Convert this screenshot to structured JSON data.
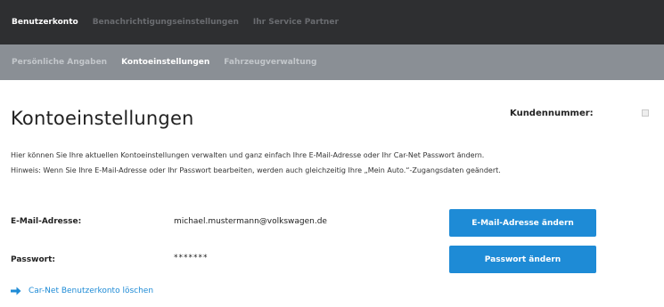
{
  "top_tabs": [
    {
      "label": "Benutzerkonto",
      "active": true
    },
    {
      "label": "Benachrichtigungseinstellungen",
      "active": false
    },
    {
      "label": "Ihr Service Partner",
      "active": false
    }
  ],
  "sub_tabs": [
    {
      "label": "Persönliche Angaben",
      "active": false
    },
    {
      "label": "Kontoeinstellungen",
      "active": true
    },
    {
      "label": "Fahrzeugverwaltung",
      "active": false
    }
  ],
  "page": {
    "title": "Kontoeinstellungen",
    "kundennummer_label": "Kundennummer:",
    "intro_line1": "Hier können Sie Ihre aktuellen Kontoeinstellungen verwalten und ganz einfach Ihre E-Mail-Adresse oder Ihr Car-Net Passwort ändern.",
    "intro_line2": "Hinweis: Wenn Sie Ihre E-Mail-Adresse oder Ihr Passwort bearbeiten, werden auch gleichzeitig Ihre „Mein Auto.“-Zugangsdaten geändert."
  },
  "email": {
    "label": "E-Mail-Adresse:",
    "value": "michael.mustermann@volkswagen.de",
    "button": "E-Mail-Adresse ändern"
  },
  "password": {
    "label": "Passwort:",
    "value": "*******",
    "button": "Passwort ändern"
  },
  "delete_link": {
    "label": "Car-Net Benutzerkonto löschen",
    "icon": "arrow-right-icon"
  },
  "colors": {
    "topnav_bg": "#2e2f31",
    "subnav_bg": "#8a8f95",
    "accent": "#1e8bd6"
  }
}
